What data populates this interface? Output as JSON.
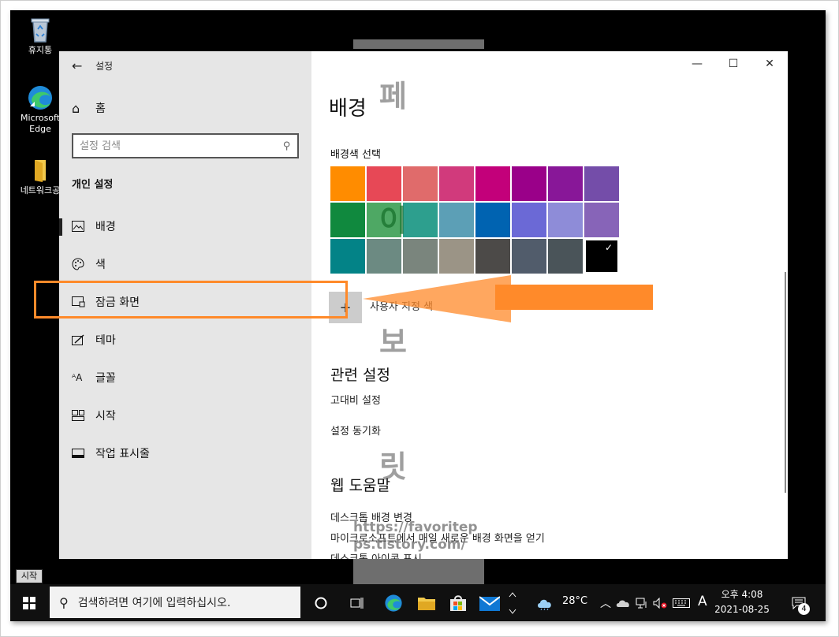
{
  "desktop": {
    "icons": [
      {
        "label": "휴지통",
        "icon": "recycle-bin-icon"
      },
      {
        "label": "Microsoft Edge",
        "icon": "edge-icon"
      },
      {
        "label": "네트워크공",
        "icon": "folder-icon"
      }
    ]
  },
  "settings": {
    "app_title": "설정",
    "home_label": "홈",
    "search": {
      "placeholder": "설정 검색",
      "value": ""
    },
    "section_title": "개인 설정",
    "nav": [
      {
        "label": "배경",
        "icon": "picture-icon",
        "active": true
      },
      {
        "label": "색",
        "icon": "palette-icon",
        "active": false
      },
      {
        "label": "잠금 화면",
        "icon": "lock-screen-icon",
        "active": false
      },
      {
        "label": "테마",
        "icon": "theme-icon",
        "active": false
      },
      {
        "label": "글꼴",
        "icon": "font-icon",
        "active": false
      },
      {
        "label": "시작",
        "icon": "start-icon",
        "active": false
      },
      {
        "label": "작업 표시줄",
        "icon": "taskbar-icon",
        "active": false
      }
    ],
    "window_controls": {
      "minimize": "—",
      "maximize": "☐",
      "close": "✕"
    }
  },
  "content": {
    "page_title": "배경",
    "color_label": "배경색 선택",
    "swatches": [
      "#ff8c00",
      "#e74856",
      "#e06b6b",
      "#d13a7c",
      "#c3007a",
      "#9a0089",
      "#881798",
      "#744da9",
      "#10893e",
      "#4ea864",
      "#2d9f8e",
      "#5c9fb6",
      "#0063b1",
      "#6b69d6",
      "#8e8cd8",
      "#8764b8",
      "#038387",
      "#6c8a82",
      "#7a857d",
      "#9b9486",
      "#4c4a48",
      "#515c6b",
      "#4a5459",
      "#000000"
    ],
    "selected_swatch": 23,
    "custom_label": "사용자 지정 색",
    "related_title": "관련 설정",
    "related_links": [
      "고대비 설정",
      "설정 동기화"
    ],
    "help_title": "웹 도움말",
    "help_links": [
      "데스크톱 배경 변경",
      "마이크로소프트에서 매일 새로운 배경 화면을 얻기",
      "데스크톱 아이콘 표시"
    ]
  },
  "watermark": {
    "chars": [
      "페",
      "이",
      "보",
      "릿"
    ],
    "url_line1": "https://favoritep",
    "url_line2": "ps.tistory.com/"
  },
  "start_tooltip": "시작",
  "taskbar": {
    "search_placeholder": "검색하려면 여기에 입력하십시오.",
    "weather": "28°C",
    "ime": "A",
    "time": "오후 4:08",
    "date": "2021-08-25",
    "notifications": "4"
  },
  "colors": {
    "accent": "#ff8a2a",
    "sidebar_bg": "#e6e6e6",
    "taskbar_bg": "#101010"
  }
}
